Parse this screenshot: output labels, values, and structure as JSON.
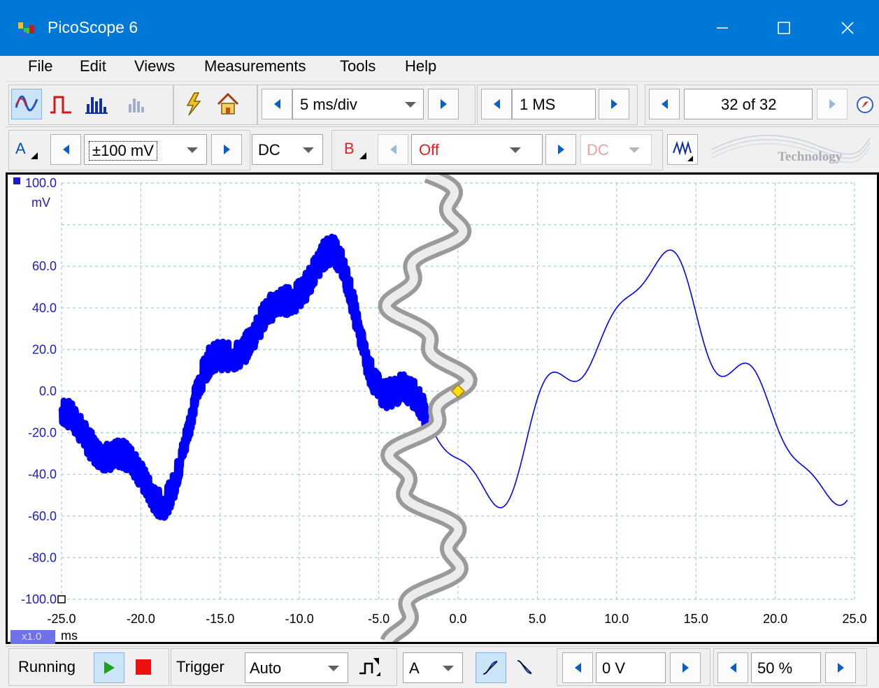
{
  "window": {
    "title": "PicoScope 6"
  },
  "menu": [
    "File",
    "Edit",
    "Views",
    "Measurements",
    "Tools",
    "Help"
  ],
  "toolbar": {
    "timebase": "5 ms/div",
    "samples": "1 MS",
    "buffer": "32 of 32"
  },
  "channels": {
    "a": {
      "label": "A",
      "range": "±100 mV",
      "coupling": "DC"
    },
    "b": {
      "label": "B",
      "range": "Off",
      "coupling": "DC"
    },
    "logo_text": "Technology"
  },
  "scope": {
    "y_top_label": "100.0",
    "y_unit": "mV",
    "x_unit": "ms",
    "zoom": "x1.0",
    "y_ticks": [
      "100.0",
      "60.0",
      "40.0",
      "20.0",
      "0.0",
      "-20.0",
      "-40.0",
      "-60.0",
      "-80.0",
      "-100.0"
    ],
    "x_ticks": [
      "-25.0",
      "-20.0",
      "-15.0",
      "-10.0",
      "-5.0",
      "0.0",
      "5.0",
      "10.0",
      "15.0",
      "20.0",
      "25.0"
    ]
  },
  "status": {
    "run_state": "Running",
    "trigger_label": "Trigger",
    "trigger_mode": "Auto",
    "trigger_source": "A",
    "threshold": "0 V",
    "pre_trigger": "50 %"
  },
  "colors": {
    "titlebar": "#0078d7",
    "trace": "#0000ff",
    "grid": "#9fd0dc",
    "channel_a": "#0050c0",
    "channel_b": "#e02020"
  }
}
